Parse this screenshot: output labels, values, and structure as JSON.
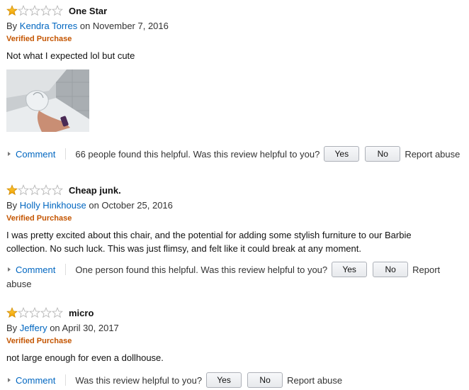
{
  "reviews": [
    {
      "rating": 1,
      "title": "One Star",
      "by_prefix": "By",
      "author": "Kendra Torres",
      "date_text": "on November 7, 2016",
      "verified": "Verified Purchase",
      "body": "Not what I expected lol but cute",
      "helpful_text": "66 people found this helpful. Was this review helpful to you?"
    },
    {
      "rating": 1,
      "title": "Cheap junk.",
      "by_prefix": "By",
      "author": "Holly Hinkhouse",
      "date_text": "on October 25, 2016",
      "verified": "Verified Purchase",
      "body": "I was pretty excited about this chair, and the potential for adding some stylish furniture to our Barbie collection. No such luck. This was just flimsy, and felt like it could break at any moment.",
      "helpful_text": "One person found this helpful. Was this review helpful to you?"
    },
    {
      "rating": 1,
      "title": "micro",
      "by_prefix": "By",
      "author": "Jeffery",
      "date_text": "on April 30, 2017",
      "verified": "Verified Purchase",
      "body": "not large enough for even a dollhouse.",
      "helpful_text": "Was this review helpful to you?"
    }
  ],
  "labels": {
    "comment": "Comment",
    "yes": "Yes",
    "no": "No",
    "report_abuse": "Report abuse",
    "report": "Report",
    "abuse": "abuse"
  },
  "colors": {
    "star_fill": "#ffa41c",
    "star_empty_stroke": "#b7b7b7",
    "link": "#0066c0",
    "verified": "#c45500"
  },
  "icons": {
    "star_filled": "star-filled-icon",
    "star_empty": "star-empty-icon",
    "expand": "triangle-right-icon"
  }
}
